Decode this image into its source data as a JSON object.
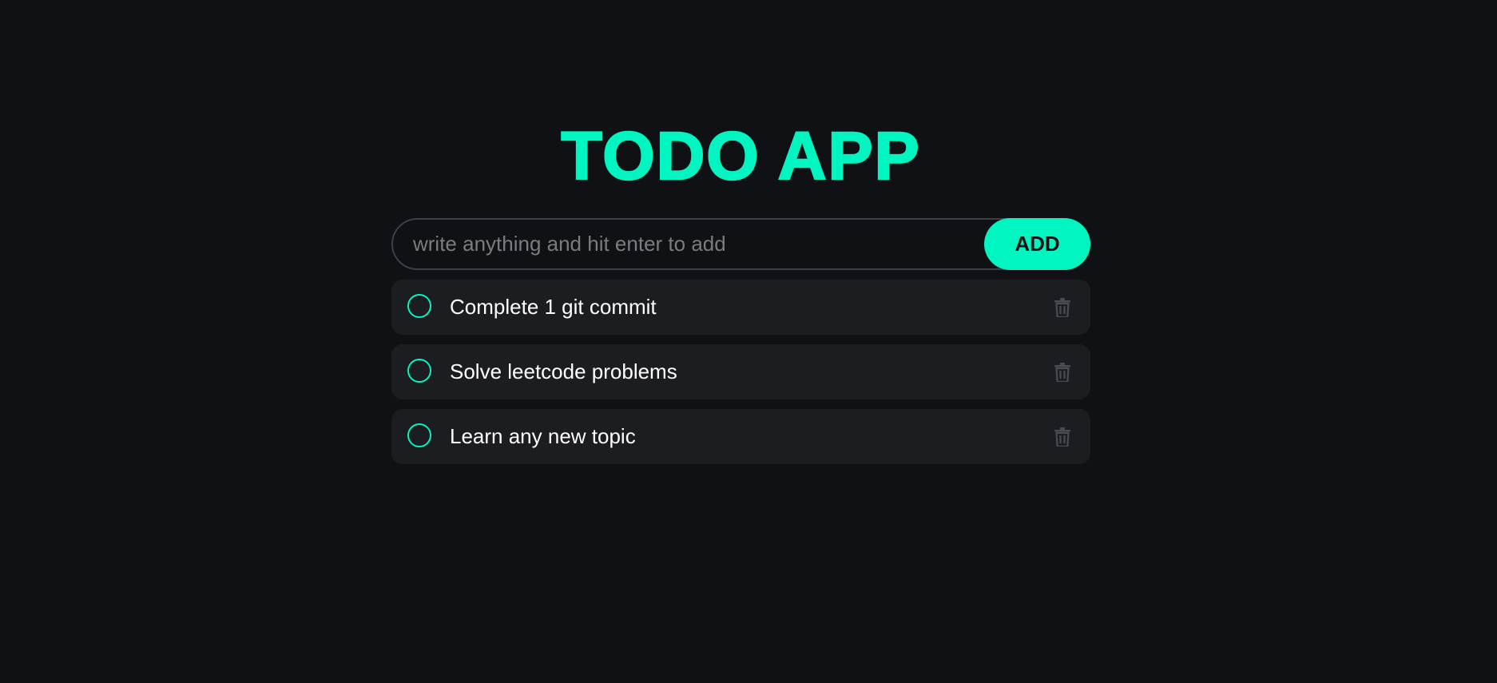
{
  "header": {
    "title": "TODO APP"
  },
  "add_form": {
    "placeholder": "write anything and hit enter to add",
    "value": "",
    "button_label": "ADD"
  },
  "todos": [
    {
      "text": "Complete 1 git commit",
      "completed": false,
      "delete_icon": "trash-icon"
    },
    {
      "text": "Solve leetcode problems",
      "completed": false,
      "delete_icon": "trash-icon"
    },
    {
      "text": "Learn any new topic",
      "completed": false,
      "delete_icon": "trash-icon"
    }
  ],
  "colors": {
    "background": "#101115",
    "accent": "#00f5c0",
    "item_background": "#1c1d21",
    "icon_muted": "#4a4c52"
  }
}
